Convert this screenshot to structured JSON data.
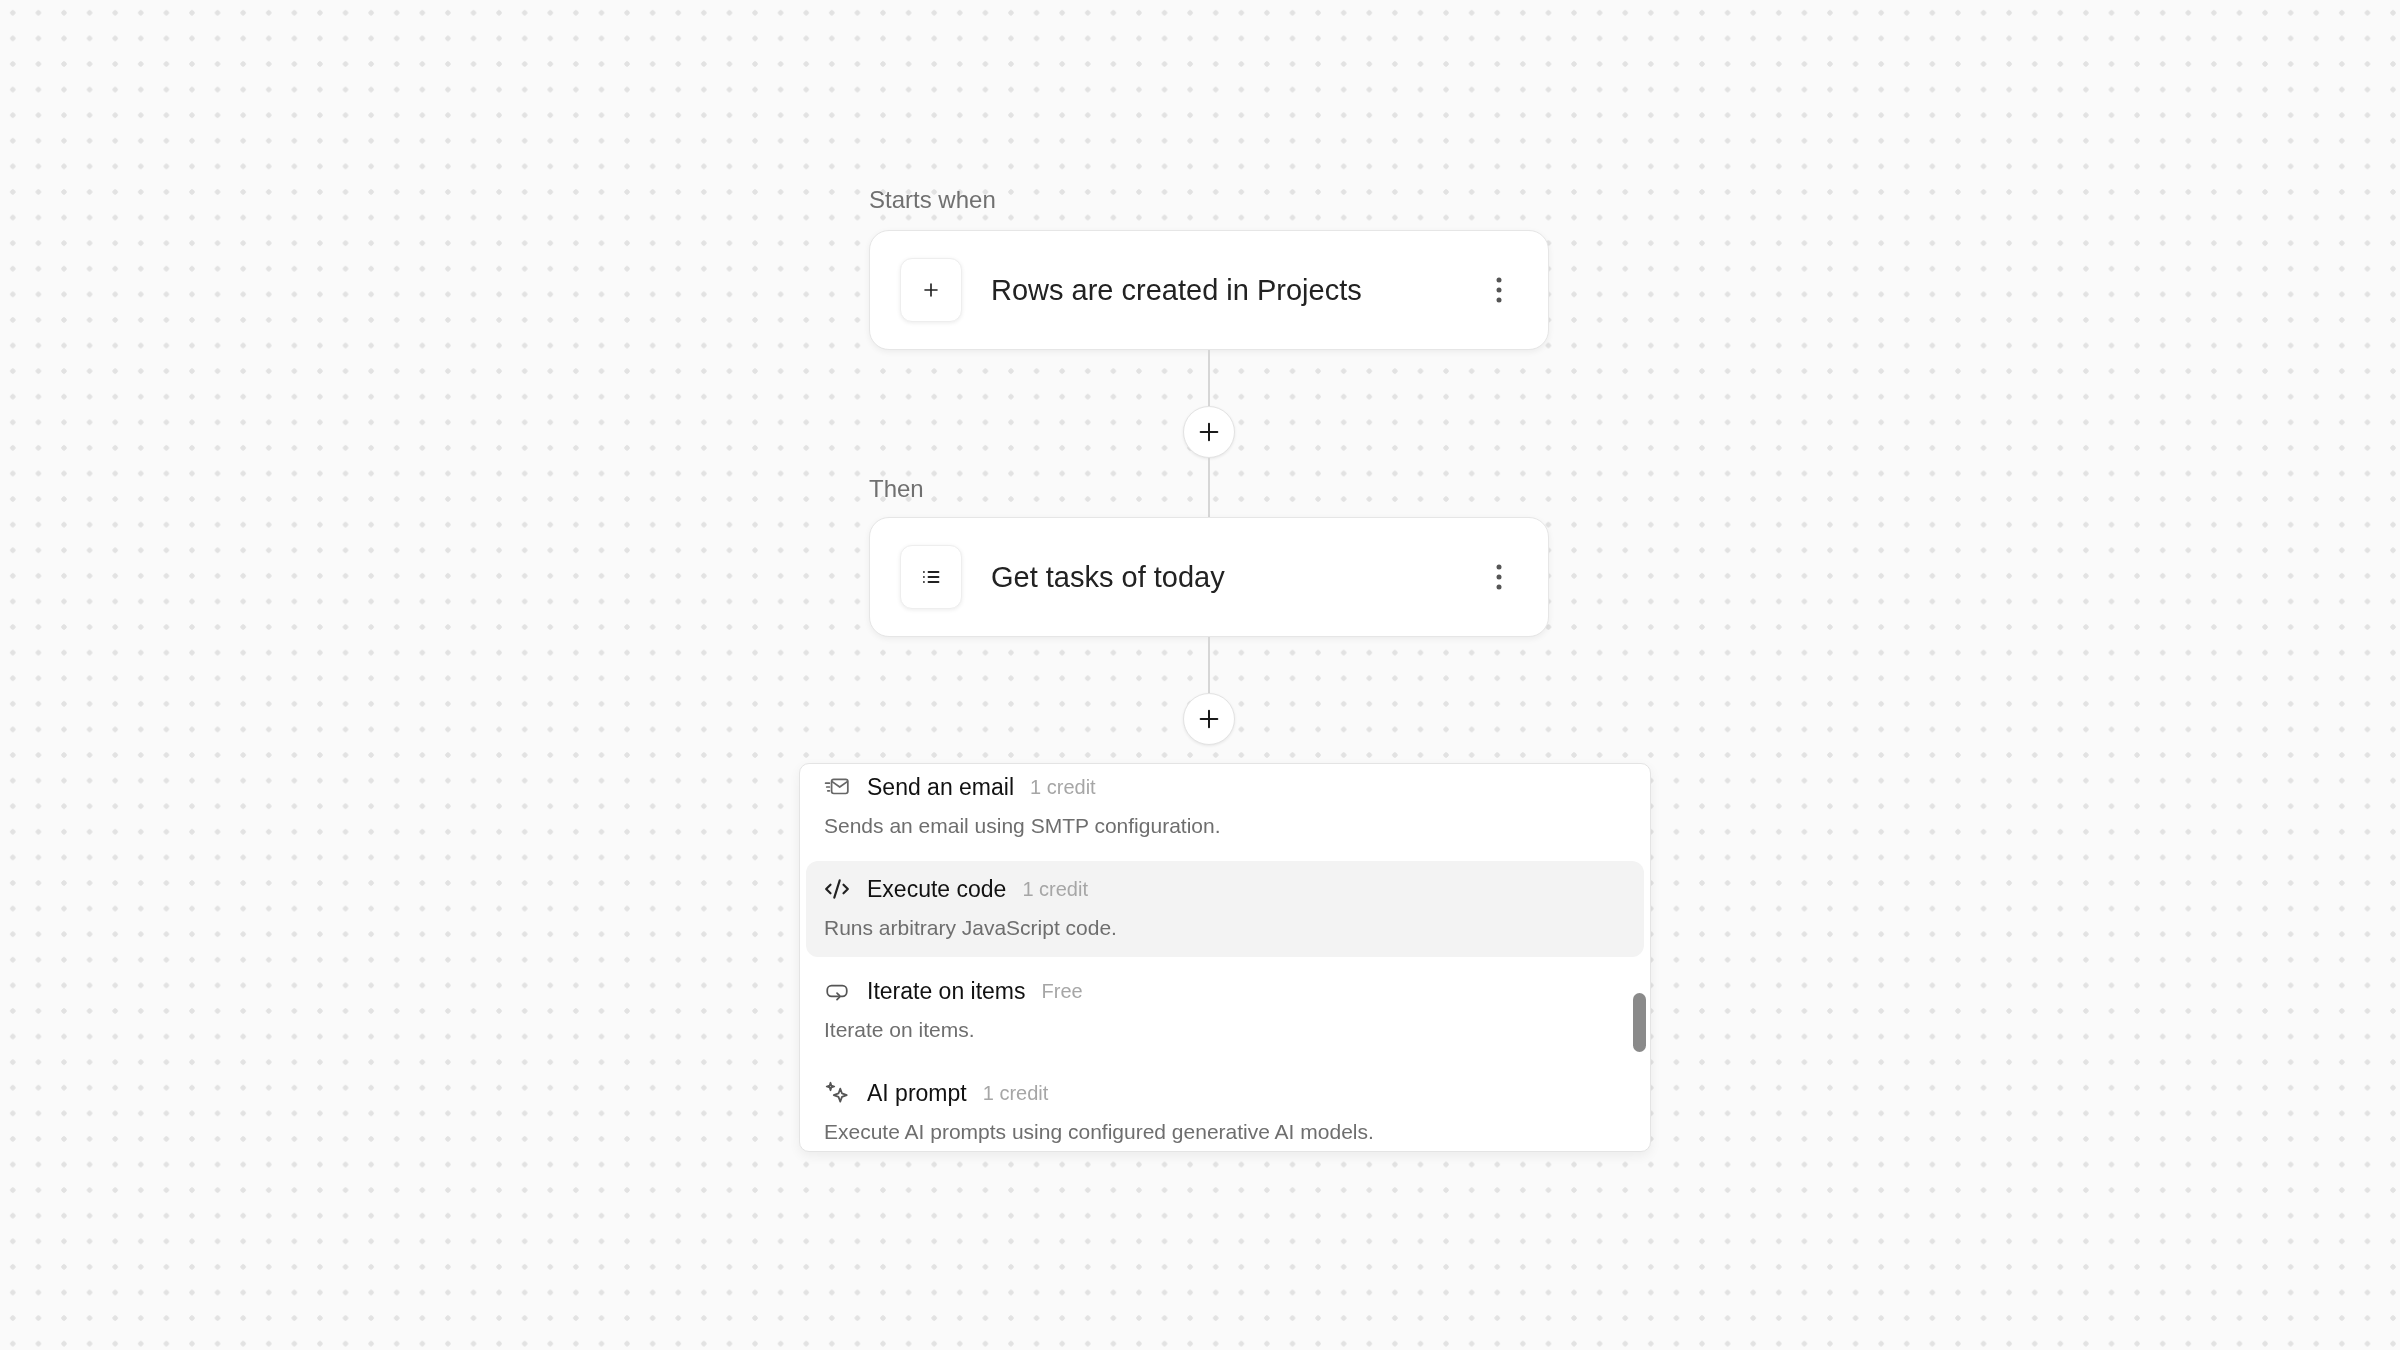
{
  "workflow": {
    "steps": [
      {
        "kind": "trigger",
        "label": "Starts when",
        "title": "Rows are created in Projects"
      },
      {
        "kind": "action",
        "label": "Then",
        "title": "Get tasks of today"
      }
    ]
  },
  "action_menu": {
    "items": [
      {
        "kind": "email",
        "title": "Send an email",
        "cost": "1 credit",
        "description": "Sends an email using SMTP configuration.",
        "selected": false
      },
      {
        "kind": "code",
        "title": "Execute code",
        "cost": "1 credit",
        "description": "Runs arbitrary JavaScript code.",
        "selected": true
      },
      {
        "kind": "loop",
        "title": "Iterate on items",
        "cost": "Free",
        "description": "Iterate on items.",
        "selected": false
      },
      {
        "kind": "ai",
        "title": "AI prompt",
        "cost": "1 credit",
        "description": "Execute AI prompts using configured generative AI models.",
        "selected": false
      }
    ]
  }
}
